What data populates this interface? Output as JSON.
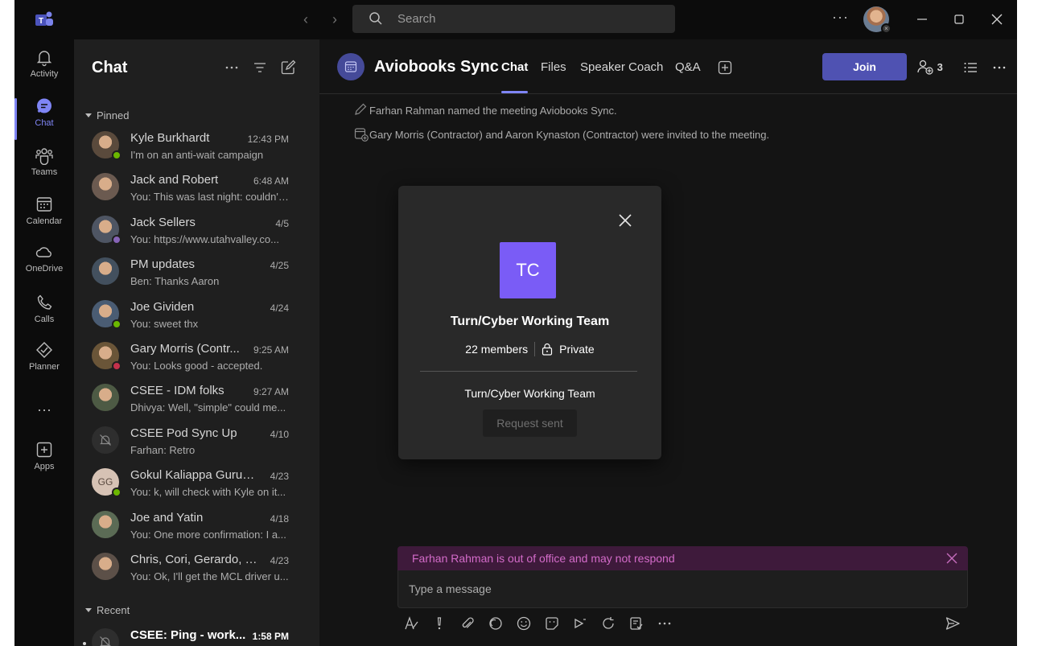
{
  "search": {
    "placeholder": "Search"
  },
  "titlebar": {
    "more": "···"
  },
  "rail": [
    {
      "label": "Activity"
    },
    {
      "label": "Chat"
    },
    {
      "label": "Teams"
    },
    {
      "label": "Calendar"
    },
    {
      "label": "OneDrive"
    },
    {
      "label": "Calls"
    },
    {
      "label": "Planner"
    },
    {
      "label": "···"
    },
    {
      "label": "Apps"
    }
  ],
  "chatpane": {
    "title": "Chat",
    "pinned_label": "Pinned",
    "recent_label": "Recent",
    "pinned": [
      {
        "name": "Kyle Burkhardt",
        "time": "12:43 PM",
        "preview": "I'm on an anti-wait campaign",
        "status": "#6bb700"
      },
      {
        "name": "Jack and Robert",
        "time": "6:48 AM",
        "preview": "You: This was last night: couldn't...",
        "status": ""
      },
      {
        "name": "Jack Sellers",
        "time": "4/5",
        "preview": "You: https://www.utahvalley.co...",
        "status": "#8764b8"
      },
      {
        "name": "PM updates",
        "time": "4/25",
        "preview": "Ben: Thanks Aaron",
        "status": ""
      },
      {
        "name": "Joe Gividen",
        "time": "4/24",
        "preview": "You: sweet thx",
        "status": "#6bb700"
      },
      {
        "name": "Gary Morris (Contr...",
        "time": "9:25 AM",
        "preview": "You: Looks good - accepted.",
        "status": "#c4314b"
      },
      {
        "name": "CSEE - IDM folks",
        "time": "9:27 AM",
        "preview": "Dhivya: Well, \"simple\" could me...",
        "status": ""
      },
      {
        "name": "CSEE Pod Sync Up",
        "time": "4/10",
        "preview": "Farhan: Retro",
        "status": ""
      },
      {
        "name": "Gokul Kaliappa Gurus...",
        "time": "4/23",
        "preview": "You: k, will check with Kyle on it...",
        "status": "#6bb700",
        "initials": "GG"
      },
      {
        "name": "Joe and Yatin",
        "time": "4/18",
        "preview": "You: One more confirmation: I a...",
        "status": ""
      },
      {
        "name": "Chris, Cori, Gerardo, +5",
        "time": "4/23",
        "preview": "You: Ok, I'll get the MCL driver u...",
        "status": ""
      }
    ],
    "recent": [
      {
        "name": "CSEE: Ping - work...",
        "time": "1:58 PM"
      }
    ]
  },
  "meeting": {
    "title": "Aviobooks Sync",
    "tabs": [
      "Chat",
      "Files",
      "Speaker Coach",
      "Q&A"
    ],
    "join_label": "Join",
    "participant_count": "3",
    "system_messages": [
      "Farhan Rahman named the meeting Aviobooks Sync.",
      "Gary Morris (Contractor) and Aaron Kynaston (Contractor) were invited to the meeting."
    ]
  },
  "modal": {
    "initials": "TC",
    "team_name": "Turn/Cyber Working Team",
    "members": "22 members",
    "privacy": "Private",
    "team_name_repeat": "Turn/Cyber Working Team",
    "request_label": "Request sent"
  },
  "composer": {
    "ooo_notice": "Farhan Rahman is out of office and may not respond",
    "placeholder": "Type a message"
  },
  "colors": {
    "accent": "#7f85f5",
    "join": "#4f52b2",
    "team_avatar": "#7a5cf6",
    "ooo_bg": "#3e1a3b",
    "ooo_text": "#d36bc9"
  }
}
